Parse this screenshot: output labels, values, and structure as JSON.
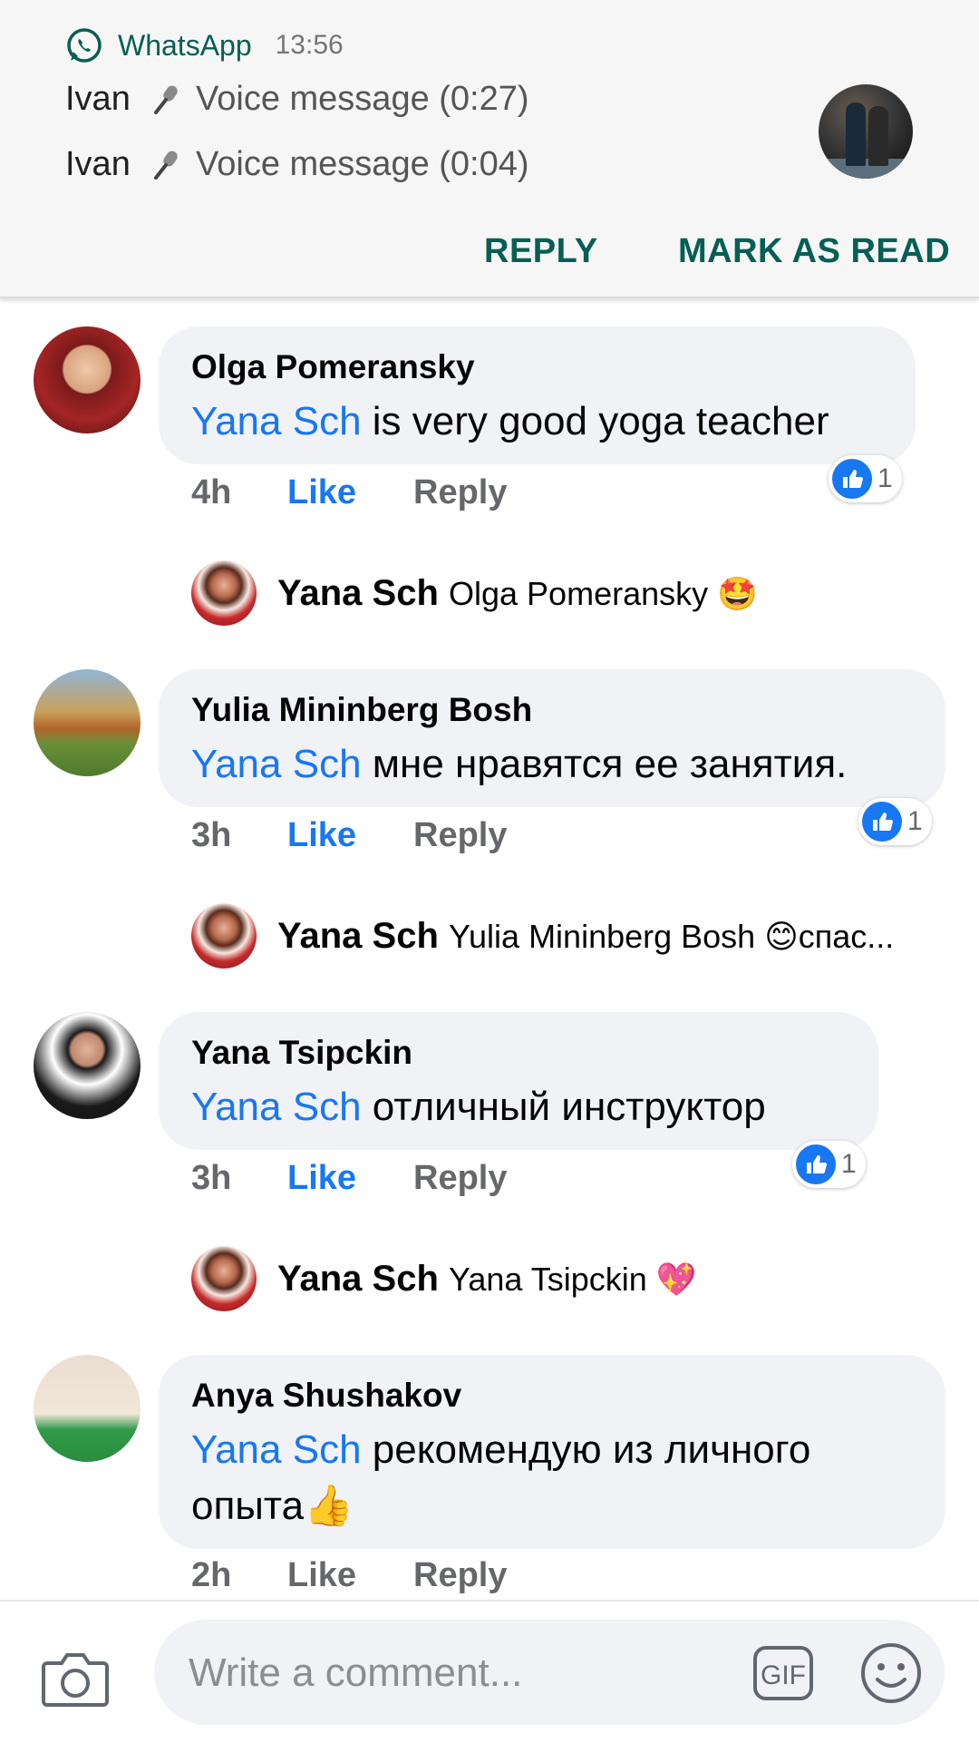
{
  "notification": {
    "app": "WhatsApp",
    "time": "13:56",
    "messages": [
      {
        "sender": "Ivan",
        "text": "Voice message (0:27)"
      },
      {
        "sender": "Ivan",
        "text": "Voice message (0:04)"
      }
    ],
    "actions": {
      "reply": "REPLY",
      "mark_read": "MARK AS READ"
    }
  },
  "comments": [
    {
      "author": "Olga Pomeransky",
      "mention": "Yana Sch",
      "text": " is very good yoga teacher",
      "time": "4h",
      "like": "Like",
      "reply": "Reply",
      "reactions": "1",
      "liked": true,
      "reply_preview": {
        "author": "Yana Sch",
        "text": "Olga Pomeransky 🤩"
      }
    },
    {
      "author": "Yulia Mininberg Bosh",
      "mention": "Yana Sch",
      "text": " мне нравятся ее занятия.",
      "time": "3h",
      "like": "Like",
      "reply": "Reply",
      "reactions": "1",
      "liked": true,
      "reply_preview": {
        "author": "Yana Sch",
        "text": "Yulia Mininberg Bosh 😊спас..."
      }
    },
    {
      "author": "Yana Tsipckin",
      "mention": "Yana Sch",
      "text": " отличный инструктор",
      "time": "3h",
      "like": "Like",
      "reply": "Reply",
      "reactions": "1",
      "liked": true,
      "reply_preview": {
        "author": "Yana Sch",
        "text": "Yana Tsipckin 💖"
      }
    },
    {
      "author": "Anya Shushakov",
      "mention": "Yana Sch",
      "text_line1": " рекомендую из личного",
      "text_line2": "опыта👍",
      "time": "2h",
      "like": "Like",
      "reply": "Reply",
      "liked": false
    }
  ],
  "composer": {
    "placeholder": "Write a comment...",
    "gif_label": "GIF"
  },
  "colors": {
    "whatsapp_green": "#075e54",
    "facebook_blue": "#1877f2",
    "bubble": "#f0f2f5",
    "meta_grey": "#65676b"
  }
}
